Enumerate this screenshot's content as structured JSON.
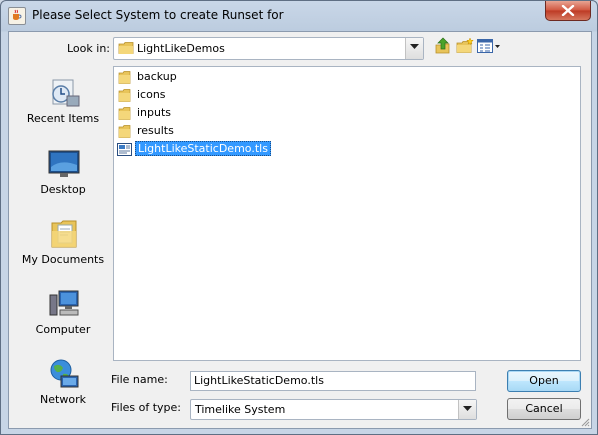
{
  "window": {
    "title": "Please Select System to create Runset for",
    "app_icon": "java-cup-icon",
    "close_icon": "close-icon"
  },
  "toolbar": {
    "look_in_label": "Look in:",
    "look_in_value": "LightLikeDemos",
    "up_button_icon": "up-folder-icon",
    "new_folder_icon": "new-folder-icon",
    "view_menu_icon": "view-menu-icon"
  },
  "places": [
    {
      "label": "Recent Items",
      "icon": "recent-items-icon"
    },
    {
      "label": "Desktop",
      "icon": "desktop-icon"
    },
    {
      "label": "My Documents",
      "icon": "my-documents-icon"
    },
    {
      "label": "Computer",
      "icon": "computer-icon"
    },
    {
      "label": "Network",
      "icon": "network-icon"
    }
  ],
  "files": [
    {
      "name": "backup",
      "type": "folder"
    },
    {
      "name": "icons",
      "type": "folder"
    },
    {
      "name": "inputs",
      "type": "folder"
    },
    {
      "name": "results",
      "type": "folder"
    },
    {
      "name": "LightLikeStaticDemo.tls",
      "type": "tls-file",
      "selected": true
    }
  ],
  "form": {
    "file_name_label": "File name:",
    "file_name_value": "LightLikeStaticDemo.tls",
    "files_of_type_label": "Files of type:",
    "files_of_type_value": "Timelike System",
    "open_label": "Open",
    "cancel_label": "Cancel"
  },
  "colors": {
    "selection": "#3399ff",
    "title_bar": "#c9d7e8",
    "close_button": "#c8452f"
  }
}
